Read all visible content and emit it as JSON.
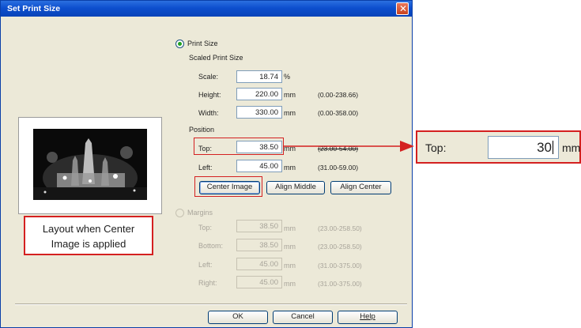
{
  "window": {
    "title": "Set Print Size"
  },
  "print_size": {
    "radio_label": "Print Size",
    "selected": true,
    "group_label": "Scaled Print Size",
    "scale": {
      "label": "Scale:",
      "value": "18.74",
      "unit": "%"
    },
    "height": {
      "label": "Height:",
      "value": "220.00",
      "unit": "mm",
      "range": "(0.00-238.66)"
    },
    "width": {
      "label": "Width:",
      "value": "330.00",
      "unit": "mm",
      "range": "(0.00-358.00)"
    }
  },
  "position": {
    "group_label": "Position",
    "top": {
      "label": "Top:",
      "value": "38.50",
      "unit": "mm",
      "range": "(23.00-54.00)"
    },
    "left": {
      "label": "Left:",
      "value": "45.00",
      "unit": "mm",
      "range": "(31.00-59.00)"
    }
  },
  "buttons": {
    "center_image": "Center Image",
    "align_middle": "Align Middle",
    "align_center": "Align Center",
    "ok": "OK",
    "cancel": "Cancel",
    "help": "Help"
  },
  "margins": {
    "radio_label": "Margins",
    "selected": false,
    "enabled": false,
    "top": {
      "label": "Top:",
      "value": "38.50",
      "unit": "mm",
      "range": "(23.00-258.50)"
    },
    "bottom": {
      "label": "Bottom:",
      "value": "38.50",
      "unit": "mm",
      "range": "(23.00-258.50)"
    },
    "left": {
      "label": "Left:",
      "value": "45.00",
      "unit": "mm",
      "range": "(31.00-375.00)"
    },
    "right": {
      "label": "Right:",
      "value": "45.00",
      "unit": "mm",
      "range": "(31.00-375.00)"
    }
  },
  "annotation": {
    "callout_line1": "Layout when Center",
    "callout_line2": "Image is applied",
    "zoom_label": "Top:",
    "zoom_value": "30",
    "zoom_unit": "mm"
  },
  "colors": {
    "annotation_red": "#d42020",
    "titlebar_blue": "#0d4fce",
    "dialog_background": "#ece9d8",
    "radio_selected_green": "#21a121"
  },
  "icons": {
    "close": "close-x-icon",
    "arrow": "right-arrow-icon"
  }
}
